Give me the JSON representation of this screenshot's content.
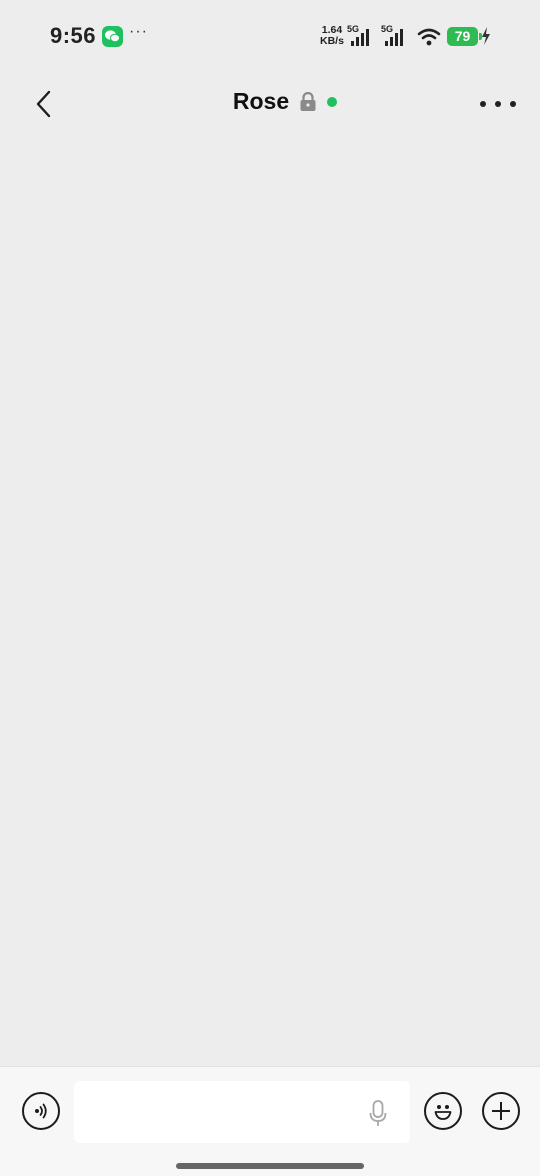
{
  "status_bar": {
    "time": "9:56",
    "notification_icon": "wechat-icon",
    "more": "···",
    "net_speed_value": "1.64",
    "net_speed_unit": "KB/s",
    "signal1_label": "5G",
    "signal2_label": "5G",
    "battery_level": "79",
    "charging": true
  },
  "nav": {
    "title": "Rose",
    "encrypted_icon": "lock-icon",
    "online_status_color": "#1fc05f",
    "back_icon": "chevron-left-icon",
    "more_icon": "more-horizontal-icon"
  },
  "input_bar": {
    "text_value": "",
    "placeholder": "",
    "left_icon": "voice-icon",
    "mic_icon": "microphone-icon",
    "emoji_icon": "emoji-icon",
    "plus_icon": "plus-icon"
  },
  "colors": {
    "background": "#ededed",
    "accent_green": "#1fc05f",
    "battery_green": "#2dbb52"
  }
}
